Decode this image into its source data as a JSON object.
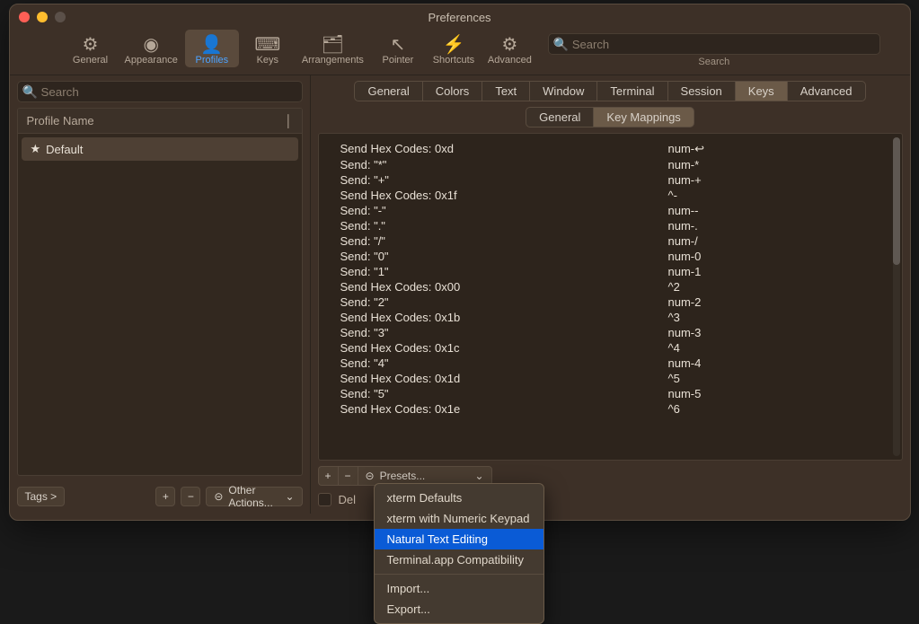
{
  "window": {
    "title": "Preferences"
  },
  "toolbar": {
    "items": [
      {
        "label": "General",
        "icon": "⚙"
      },
      {
        "label": "Appearance",
        "icon": "◉"
      },
      {
        "label": "Profiles",
        "icon": "👤"
      },
      {
        "label": "Keys",
        "icon": "⌨"
      },
      {
        "label": "Arrangements",
        "icon": "🗂"
      },
      {
        "label": "Pointer",
        "icon": "↖"
      },
      {
        "label": "Shortcuts",
        "icon": "⚡"
      },
      {
        "label": "Advanced",
        "icon": "⚙"
      }
    ],
    "selected_index": 2,
    "search": {
      "placeholder": "Search",
      "label": "Search"
    }
  },
  "sidebar": {
    "search_placeholder": "Search",
    "header": "Profile Name",
    "profiles": [
      {
        "name": "Default",
        "starred": true,
        "selected": true
      }
    ],
    "tags_label": "Tags >",
    "other_actions_label": "Other Actions..."
  },
  "main": {
    "top_tabs": [
      "General",
      "Colors",
      "Text",
      "Window",
      "Terminal",
      "Session",
      "Keys",
      "Advanced"
    ],
    "top_selected_index": 6,
    "sub_tabs": [
      "General",
      "Key Mappings"
    ],
    "sub_selected_index": 1,
    "mappings": [
      {
        "action": "Send Hex Codes: 0xd",
        "shortcut": "num-↩"
      },
      {
        "action": "Send: \"*\"",
        "shortcut": "num-*"
      },
      {
        "action": "Send: \"+\"",
        "shortcut": "num-+"
      },
      {
        "action": "Send Hex Codes: 0x1f",
        "shortcut": "^-"
      },
      {
        "action": "Send: \"-\"",
        "shortcut": "num--"
      },
      {
        "action": "Send: \".\"",
        "shortcut": "num-."
      },
      {
        "action": "Send: \"/\"",
        "shortcut": "num-/"
      },
      {
        "action": "Send: \"0\"",
        "shortcut": "num-0"
      },
      {
        "action": "Send: \"1\"",
        "shortcut": "num-1"
      },
      {
        "action": "Send Hex Codes: 0x00",
        "shortcut": "^2"
      },
      {
        "action": "Send: \"2\"",
        "shortcut": "num-2"
      },
      {
        "action": "Send Hex Codes: 0x1b",
        "shortcut": "^3"
      },
      {
        "action": "Send: \"3\"",
        "shortcut": "num-3"
      },
      {
        "action": "Send Hex Codes: 0x1c",
        "shortcut": "^4"
      },
      {
        "action": "Send: \"4\"",
        "shortcut": "num-4"
      },
      {
        "action": "Send Hex Codes: 0x1d",
        "shortcut": "^5"
      },
      {
        "action": "Send: \"5\"",
        "shortcut": "num-5"
      },
      {
        "action": "Send Hex Codes: 0x1e",
        "shortcut": "^6"
      }
    ],
    "presets_label": "Presets...",
    "delete_send_label": "Del"
  },
  "popup": {
    "items": [
      "xterm Defaults",
      "xterm with Numeric Keypad",
      "Natural Text Editing",
      "Terminal.app Compatibility"
    ],
    "selected_index": 2,
    "footer": [
      "Import...",
      "Export..."
    ]
  }
}
